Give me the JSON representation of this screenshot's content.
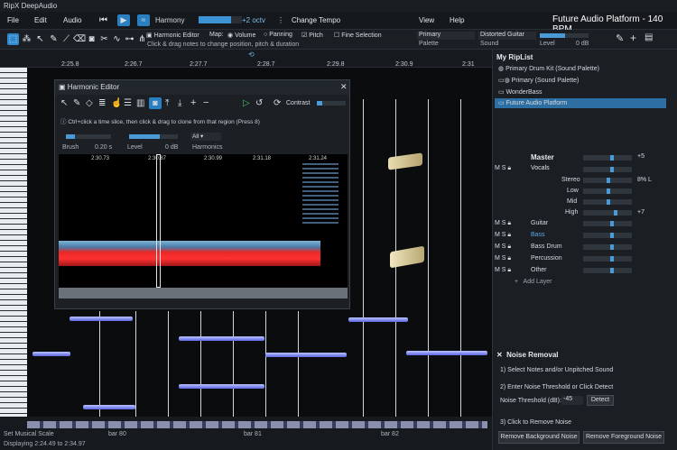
{
  "app": {
    "title": "RipX DeepAudio",
    "project": "Future Audio Platform - 140 BPM"
  },
  "menu": {
    "file": "File",
    "edit": "Edit",
    "audio": "Audio",
    "view": "View",
    "help": "Help",
    "harmony": "Harmony",
    "octave": "+2 octv",
    "change_tempo": "Change Tempo"
  },
  "toolbar": {
    "harmonic_editor": "Harmonic Editor",
    "map": "Map:",
    "volume": "Volume",
    "panning": "Panning",
    "pitch": "Pitch",
    "fine_selection": "Fine Selection",
    "hint": "Click & drag notes to change position, pitch & duration",
    "primary": "Primary",
    "palette": "Palette",
    "distorted_guitar": "Distorted Guitar",
    "sound": "Sound",
    "level": "Level",
    "level_value": "0 dB"
  },
  "ruler": {
    "ticks": [
      "2:25.8",
      "2:26.7",
      "2:27.7",
      "2:28.7",
      "2:29.8",
      "2:30.9",
      "2:31"
    ]
  },
  "editor": {
    "title": "Harmonic Editor",
    "contrast": "Contrast",
    "hint": "Ctrl+click a time slice, then click & drag to clone from that region  (Press 8)",
    "brush": "Brush",
    "brush_value": "0.20 s",
    "level": "Level",
    "level_value": "0 dB",
    "harmonics_sel": "All",
    "harmonics": "Harmonics",
    "ticks": [
      "2:30.73",
      "2:30.87",
      "2:30.99",
      "2:31.18",
      "2:31.24"
    ]
  },
  "riplist": {
    "title": "My RipList",
    "items": [
      "Primary Drum Kit (Sound Palette)",
      "Primary (Sound Palette)",
      "WonderBass",
      "Future Audio Platform"
    ]
  },
  "mixer": {
    "master": "Master",
    "master_value": "+5",
    "vocals": "Vocals",
    "stereo": "Stereo",
    "stereo_value": "8% L",
    "low": "Low",
    "mid": "Mid",
    "high": "High",
    "high_value": "+7",
    "tracks": [
      "Guitar",
      "Bass",
      "Bass Drum",
      "Percussion",
      "Other"
    ],
    "add_layer": "Add Layer"
  },
  "noise": {
    "title": "Noise Removal",
    "step1": "1) Select Notes and/or Unpitched Sound",
    "step2": "2) Enter Noise Threshold or Click Detect",
    "threshold_label": "Noise Threshold (dB):",
    "threshold_value": "-45",
    "detect": "Detect",
    "step3": "3) Click to Remove Noise",
    "remove_bg": "Remove Background Noise",
    "remove_fg": "Remove Foreground Noise"
  },
  "bottom": {
    "set_scale": "Set Musical Scale",
    "bar80": "bar 80",
    "bar81": "bar 81",
    "bar82": "bar 82",
    "status": "Displaying 2:24.49 to 2:34.97"
  }
}
